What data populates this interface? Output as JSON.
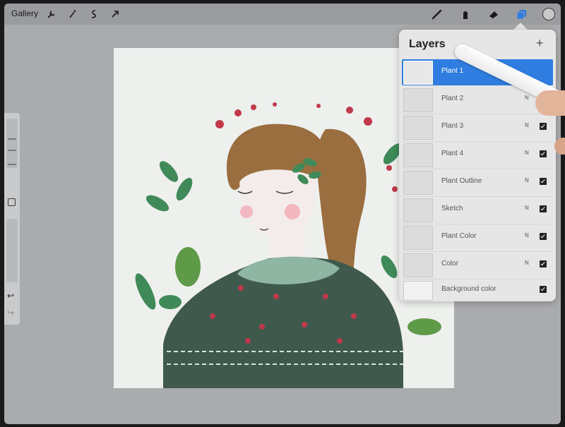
{
  "toolbar": {
    "gallery_label": "Gallery",
    "left_tools": [
      "wrench-icon",
      "magic-wand-icon",
      "selection-icon",
      "transform-arrow-icon"
    ],
    "right_tools": [
      "brush-icon",
      "smudge-icon",
      "eraser-icon",
      "layers-icon"
    ],
    "active_tool": "layers-icon",
    "active_color": "#2f7de1"
  },
  "layers": {
    "title": "Layers",
    "add_label": "+",
    "items": [
      {
        "name": "Plant 1",
        "mode": "N",
        "visible": true,
        "active": true
      },
      {
        "name": "Plant 2",
        "mode": "N",
        "visible": true,
        "active": false
      },
      {
        "name": "Plant 3",
        "mode": "N",
        "visible": true,
        "active": false
      },
      {
        "name": "Plant 4",
        "mode": "N",
        "visible": true,
        "active": false
      },
      {
        "name": "Plant Outline",
        "mode": "N",
        "visible": true,
        "active": false
      },
      {
        "name": "Sketch",
        "mode": "N",
        "visible": true,
        "active": false
      },
      {
        "name": "Plant Color",
        "mode": "N",
        "visible": true,
        "active": false
      },
      {
        "name": "Color",
        "mode": "N",
        "visible": true,
        "active": false
      },
      {
        "name": "Background color",
        "mode": "",
        "visible": true,
        "active": false
      }
    ]
  },
  "sidebar": {
    "undo_label": "↩",
    "redo_label": "↪"
  },
  "colors": {
    "hair": "#9a6e3f",
    "sweater": "#3f5a4c",
    "berry": "#c0394a",
    "leaf": "#3f8a58"
  }
}
